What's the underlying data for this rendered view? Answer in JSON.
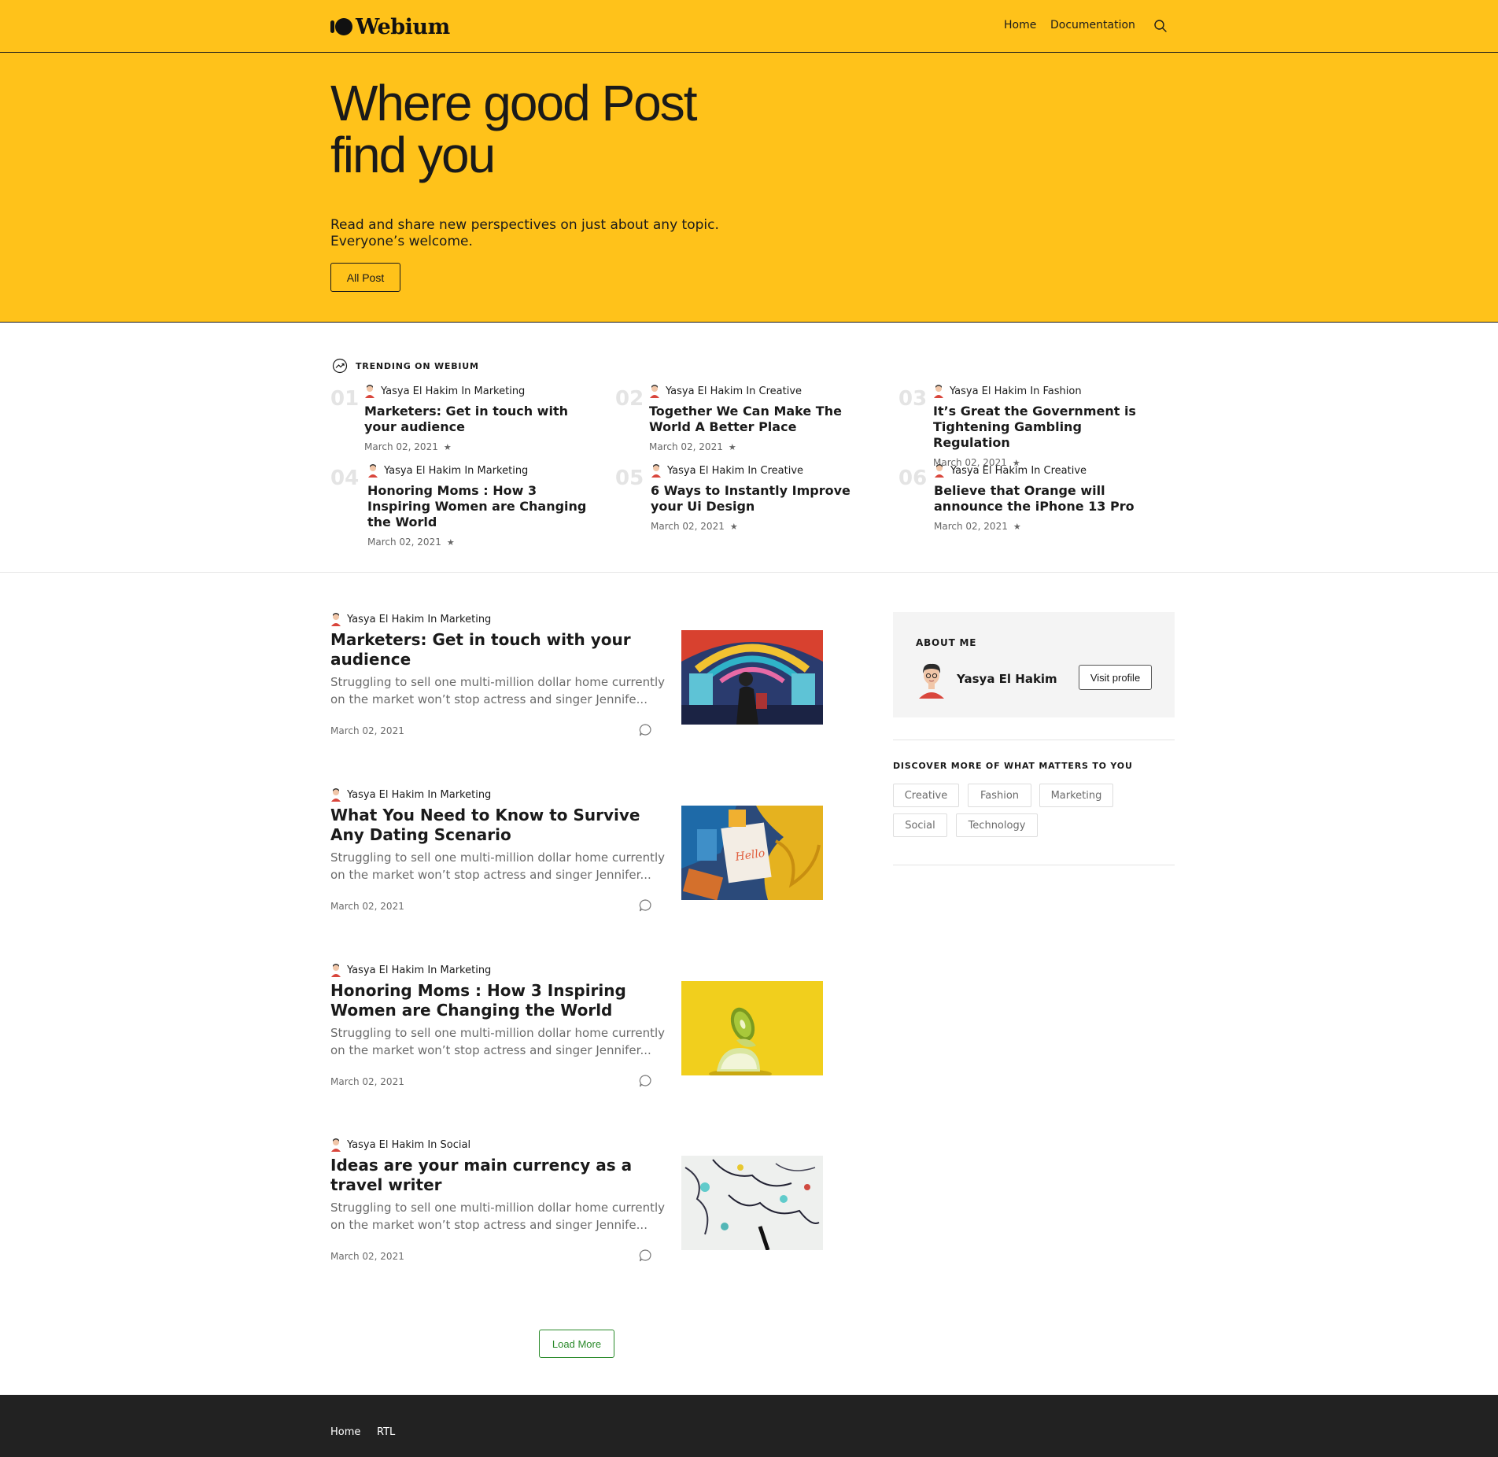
{
  "header": {
    "logo_text": "Webium",
    "nav": [
      "Home",
      "Documentation"
    ],
    "search_icon": "search-icon"
  },
  "hero": {
    "title_line1": "Where good Post",
    "title_line2": "find you",
    "subtitle_line1": "Read and share new perspectives on just about any topic.",
    "subtitle_line2": "Everyone’s welcome.",
    "button_label": "All Post",
    "bg_color": "#FFC21A"
  },
  "trending": {
    "label": "TRENDING ON WEBIUM",
    "items": [
      {
        "num": "01",
        "author": "Yasya El Hakim In Marketing",
        "title": "Marketers: Get in touch with your audience",
        "date": "March 02, 2021"
      },
      {
        "num": "02",
        "author": "Yasya El Hakim In Creative",
        "title": "Together We Can Make The World A Better Place",
        "date": "March 02, 2021"
      },
      {
        "num": "03",
        "author": "Yasya El Hakim In Fashion",
        "title": "It’s Great the Government is Tightening Gambling Regulation",
        "date": "March 02, 2021"
      },
      {
        "num": "04",
        "author": "Yasya El Hakim In Marketing",
        "title": "Honoring Moms : How 3 Inspiring Women are Changing the World",
        "date": "March 02, 2021"
      },
      {
        "num": "05",
        "author": "Yasya El Hakim In Creative",
        "title": "6 Ways to Instantly Improve your Ui Design",
        "date": "March 02, 2021"
      },
      {
        "num": "06",
        "author": "Yasya El Hakim In Creative",
        "title": "Believe that Orange will announce the iPhone 13 Pro",
        "date": "March 02, 2021"
      }
    ]
  },
  "posts": [
    {
      "author": "Yasya El Hakim In Marketing",
      "title": "Marketers: Get in touch with your audience",
      "excerpt": "Struggling to sell one multi-million dollar home currently on the market won’t stop actress and singer Jennife...",
      "date": "March 02, 2021"
    },
    {
      "author": "Yasya El Hakim In Marketing",
      "title": "What You Need to Know to Survive Any Dating Scenario",
      "excerpt": "Struggling to sell one multi-million dollar home currently on the market won’t stop actress and singer Jennifer...",
      "date": "March 02, 2021"
    },
    {
      "author": "Yasya El Hakim In Marketing",
      "title": "Honoring Moms : How 3 Inspiring Women are Changing the World",
      "excerpt": "Struggling to sell one multi-million dollar home currently on the market won’t stop actress and singer Jennifer...",
      "date": "March 02, 2021"
    },
    {
      "author": "Yasya El Hakim In Social",
      "title": "Ideas are your main currency as a travel writer",
      "excerpt": "Struggling to sell one multi-million dollar home currently on the market won’t stop actress and singer Jennife...",
      "date": "March 02, 2021"
    }
  ],
  "load_more_label": "Load More",
  "sidebar": {
    "about_label": "ABOUT ME",
    "name": "Yasya El Hakim",
    "visit_label": "Visit profile",
    "discover_label": "DISCOVER MORE OF WHAT MATTERS TO YOU",
    "tags": [
      "Creative",
      "Fashion",
      "Marketing",
      "Social",
      "Technology"
    ]
  },
  "footer": {
    "links": [
      "Home",
      "RTL"
    ]
  }
}
